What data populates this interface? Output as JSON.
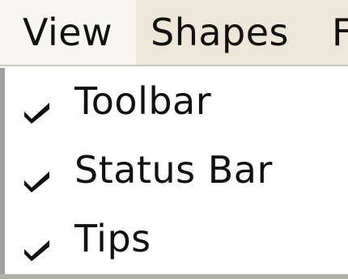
{
  "menubar": {
    "items": [
      {
        "label": "View"
      },
      {
        "label": "Shapes"
      },
      {
        "label": "F"
      }
    ]
  },
  "dropdown": {
    "items": [
      {
        "label": "Toolbar",
        "checked": true,
        "icon": "checkmark-icon"
      },
      {
        "label": "Status Bar",
        "checked": true,
        "icon": "checkmark-icon"
      },
      {
        "label": "Tips",
        "checked": true,
        "icon": "checkmark-icon"
      }
    ]
  },
  "colors": {
    "menubar_bg": "#ebe8d9",
    "active_menu_bg": "#f7f6f1",
    "dropdown_bg": "#ffffff",
    "text": "#111111"
  }
}
